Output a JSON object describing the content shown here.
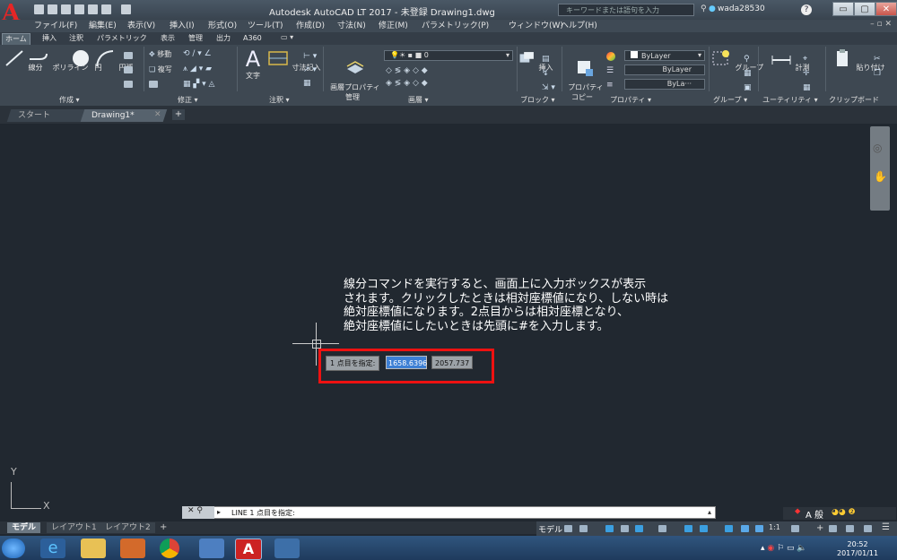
{
  "window": {
    "title": "Autodesk AutoCAD LT 2017 - 未登録    Drawing1.dwg",
    "search_placeholder": "キーワードまたは語句を入力",
    "user": "wada28530",
    "app_letter": "A",
    "app_sub": "LT"
  },
  "menu": [
    "ファイル(F)",
    "編集(E)",
    "表示(V)",
    "挿入(I)",
    "形式(O)",
    "ツール(T)",
    "作成(D)",
    "寸法(N)",
    "修正(M)",
    "パラメトリック(P)",
    "ウィンドウ(W)",
    "ヘルプ(H)"
  ],
  "ribbon_tabs": [
    "ホーム",
    "挿入",
    "注釈",
    "パラメトリック",
    "表示",
    "管理",
    "出力",
    "A360"
  ],
  "ribbon": {
    "draw": {
      "line": "線分",
      "polyline": "ポリライン",
      "circle": "円",
      "arc": "円弧",
      "label": "作成 ▾"
    },
    "modify": {
      "move": "移動",
      "copy": "複写",
      "label": "修正 ▾"
    },
    "annotation": {
      "text": "文字",
      "dimension": "寸法記入",
      "label": "注釈 ▾"
    },
    "layers": {
      "properties": "画層プロパティ\n管理",
      "layer_value": "0",
      "label": "画層 ▾"
    },
    "block": {
      "insert": "挿入",
      "label": "ブロック ▾"
    },
    "properties": {
      "match": "プロパティ\nコピー",
      "bylayer1": "ByLayer",
      "bylayer2": "ByLayer",
      "bylayer3": "ByLa···",
      "label": "プロパティ ▾"
    },
    "groups": {
      "group": "グループ",
      "label": "グループ ▾"
    },
    "utilities": {
      "measure": "計測",
      "label": "ユーティリティ ▾"
    },
    "clipboard": {
      "paste": "貼り付け",
      "label": "クリップボード"
    }
  },
  "doc_tabs": [
    "スタート",
    "Drawing1*"
  ],
  "instructions": "線分コマンドを実行すると、画面上に入力ボックスが表示\nされます。クリックしたときは相対座標値になり、しない時は\n絶対座標値になります。2点目からは相対座標となり、\n絶対座標値にしたいときは先頭に#を入力します。",
  "dynamic_input": {
    "prompt": "1 点目を指定:",
    "x": "1658.6396",
    "y": "2057.737"
  },
  "ucs": {
    "y": "Y",
    "x": "X"
  },
  "command_line": "LINE 1 点目を指定:",
  "layout_tabs": [
    "モデル",
    "レイアウト1",
    "レイアウト2"
  ],
  "status": {
    "model": "モデル",
    "scale": "1:1"
  },
  "clock": {
    "time": "20:52",
    "date": "2017/01/11"
  },
  "ime": "A 般"
}
